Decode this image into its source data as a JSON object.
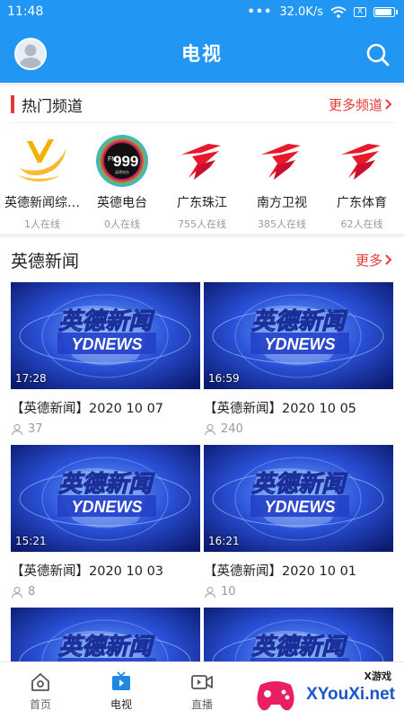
{
  "status_bar": {
    "time": "11:48",
    "dots": "•••",
    "speed": "32.0K/s",
    "sim": "X"
  },
  "app_bar": {
    "title": "电视"
  },
  "hot_channels": {
    "title": "热门频道",
    "more_label": "更多频道",
    "items": [
      {
        "name": "英德新闻综…",
        "online": "1人在线",
        "logo": "yingde-logo"
      },
      {
        "name": "英德电台",
        "online": "0人在线",
        "logo": "fm999-logo"
      },
      {
        "name": "广东珠江",
        "online": "755人在线",
        "logo": "gdtv-logo"
      },
      {
        "name": "南方卫视",
        "online": "385人在线",
        "logo": "gdtv-logo"
      },
      {
        "name": "广东体育",
        "online": "62人在线",
        "logo": "gdtv-logo"
      }
    ]
  },
  "fm_logo": {
    "big": "999",
    "prefix": "FM",
    "sub": "英德电台"
  },
  "news": {
    "title": "英德新闻",
    "more_label": "更多",
    "thumb_text_cn": "英德新闻",
    "thumb_text_en": "YDNEWS",
    "videos": [
      {
        "title": "【英德新闻】2020 10 07",
        "duration": "17:28",
        "views": "37"
      },
      {
        "title": "【英德新闻】2020 10 05",
        "duration": "16:59",
        "views": "240"
      },
      {
        "title": "【英德新闻】2020 10 03",
        "duration": "15:21",
        "views": "8"
      },
      {
        "title": "【英德新闻】2020 10 01",
        "duration": "16:21",
        "views": "10"
      },
      {
        "title": "",
        "duration": "",
        "views": ""
      },
      {
        "title": "",
        "duration": "",
        "views": ""
      }
    ]
  },
  "tabs": [
    {
      "label": "首页",
      "icon": "home-icon"
    },
    {
      "label": "电视",
      "icon": "tv-icon"
    },
    {
      "label": "直播",
      "icon": "video-camera-icon"
    }
  ],
  "watermark": {
    "site": "XYouXi.net",
    "small": "X游戏"
  },
  "colors": {
    "primary": "#2196f3",
    "accent": "#e53935",
    "tab_active": "#1e88e5"
  }
}
